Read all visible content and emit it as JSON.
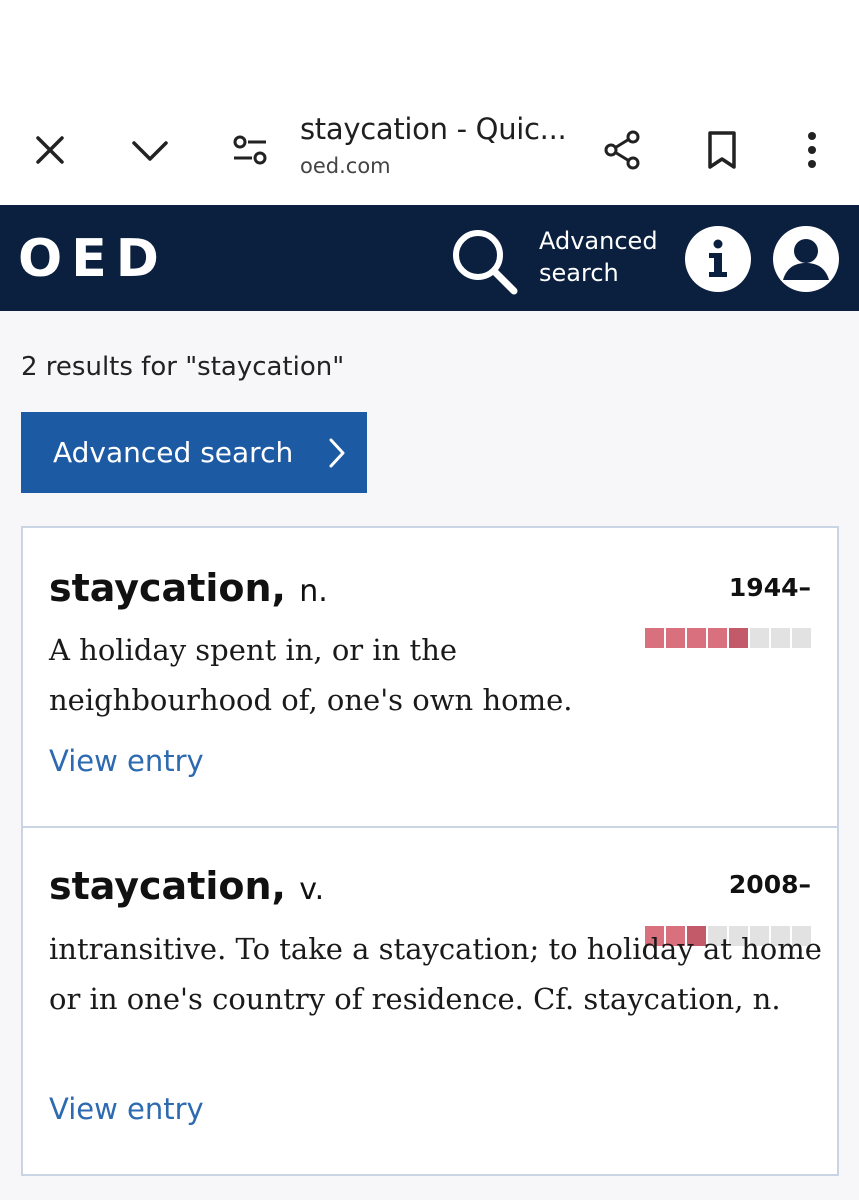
{
  "browser": {
    "page_title": "staycation - Quic...",
    "domain": "oed.com"
  },
  "header": {
    "logo": "OED",
    "advanced_search_line1": "Advanced",
    "advanced_search_line2": "search"
  },
  "search": {
    "results_count": "2 results for \"staycation\"",
    "advanced_button_label": "Advanced search"
  },
  "results": [
    {
      "headword": "staycation,",
      "pos": "n.",
      "date": "1944–",
      "frequency_band": 5,
      "frequency_max": 8,
      "definition": "A holiday spent in, or in the neighbourhood of, one's own home.",
      "link": "View entry"
    },
    {
      "headword": "staycation,",
      "pos": "v.",
      "date": "2008–",
      "frequency_band": 3,
      "frequency_max": 8,
      "definition": "intransitive. To take a staycation; to holiday at home or in one's country of residence. Cf. staycation, n.",
      "link": "View entry"
    }
  ],
  "colors": {
    "header_bg": "#0b1f3f",
    "button_bg": "#1c5aa3",
    "link": "#2d6ab0",
    "freq_on": "#d9707e",
    "freq_on_dark": "#c25a6a",
    "freq_off": "#e2e2e2"
  }
}
